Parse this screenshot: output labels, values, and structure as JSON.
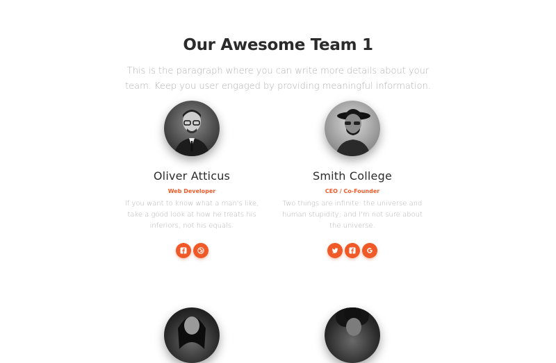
{
  "section": {
    "title": "Our Awesome Team 1",
    "description": "This is the paragraph where you can write more details about your team. Keep you user engaged by providing meaningful information."
  },
  "team": [
    {
      "name": "Oliver Atticus",
      "role": "Web Developer",
      "bio": "If you want to know what a man's like, take a good look at how he treats his inferiors, not his equals.",
      "social": [
        "facebook-icon",
        "dribbble-icon"
      ]
    },
    {
      "name": "Smith College",
      "role": "CEO / Co-Founder",
      "bio": "Two things are infinite: the universe and human stupidity; and I'm not sure about the universe.",
      "social": [
        "twitter-icon",
        "facebook-icon",
        "google-icon"
      ]
    }
  ],
  "colors": {
    "accent": "#f05a28",
    "title": "#2b2b2b",
    "muted": "#b3b3b3"
  }
}
